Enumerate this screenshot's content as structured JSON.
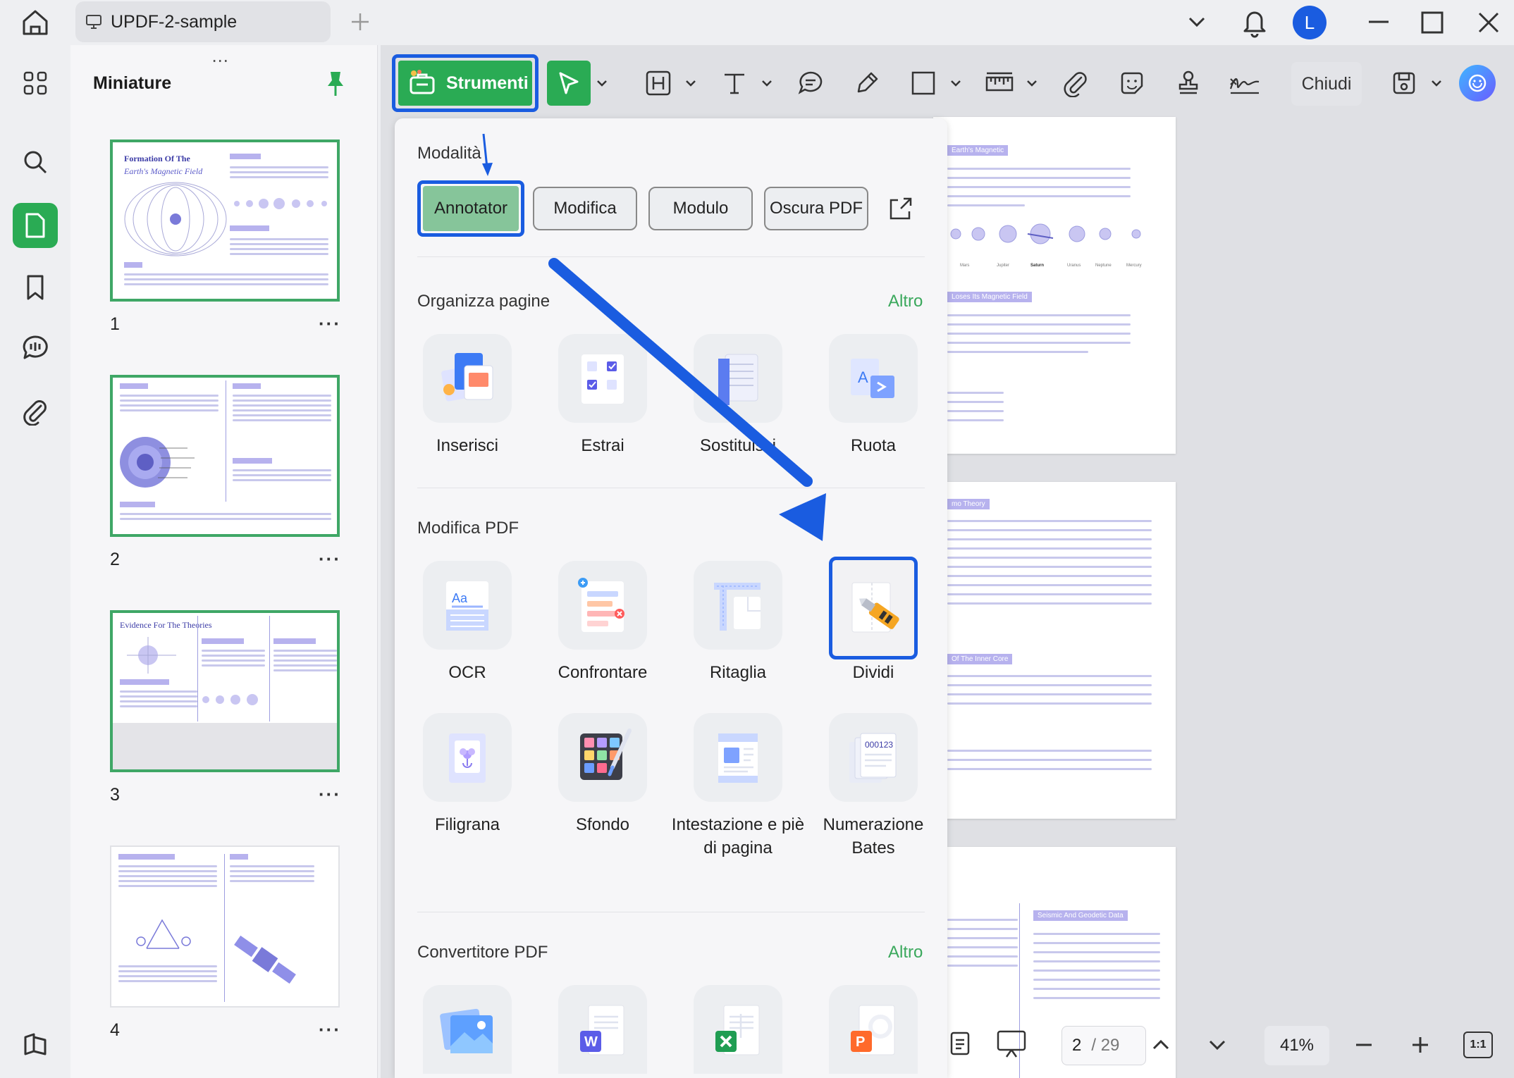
{
  "tab": {
    "title": "UPDF-2-sample"
  },
  "user": {
    "avatar_letter": "L",
    "avatar_color": "#1a5ce0"
  },
  "thumbnails": {
    "title": "Miniature",
    "pages": [
      {
        "number": "1",
        "heading": "Formation Of The",
        "subheading": "Earth's Magnetic Field"
      },
      {
        "number": "2"
      },
      {
        "number": "3",
        "heading": "Evidence For The Theories"
      },
      {
        "number": "4"
      }
    ],
    "more_glyph": "···"
  },
  "toolbar": {
    "strumenti_label": "Strumenti",
    "chiudi_label": "Chiudi"
  },
  "tools_panel": {
    "mode_title": "Modalità",
    "modes": [
      "Annotator",
      "Modifica",
      "Modulo",
      "Oscura PDF"
    ],
    "organize": {
      "title": "Organizza pagine",
      "more": "Altro",
      "items": [
        "Inserisci",
        "Estrai",
        "Sostituisci",
        "Ruota"
      ]
    },
    "edit": {
      "title": "Modifica PDF",
      "items": [
        "OCR",
        "Confrontare",
        "Ritaglia",
        "Dividi",
        "Filigrana",
        "Sfondo",
        "Intestazione e piè di pagina",
        "Numerazione Bates"
      ]
    },
    "converter": {
      "title": "Convertitore PDF",
      "more": "Altro"
    }
  },
  "document": {
    "page1_heading1": "Earth's Magnetic",
    "page1_heading2": "Loses Its Magnetic Field",
    "page2_heading1": "mo Theory",
    "page2_heading2": "Of The Inner Core",
    "page3_heading": "Seismic And Geodetic Data",
    "planets": [
      "Mars",
      "Jupiter",
      "Saturn",
      "Uranus",
      "Neptune",
      "Mercury"
    ]
  },
  "pagination": {
    "current": "2",
    "total": "/ 29",
    "zoom": "41%",
    "fit_label": "1:1"
  },
  "colors": {
    "accent_green": "#2aab54",
    "highlight_blue": "#1a5ce0",
    "altro_green": "#3aa85c"
  }
}
